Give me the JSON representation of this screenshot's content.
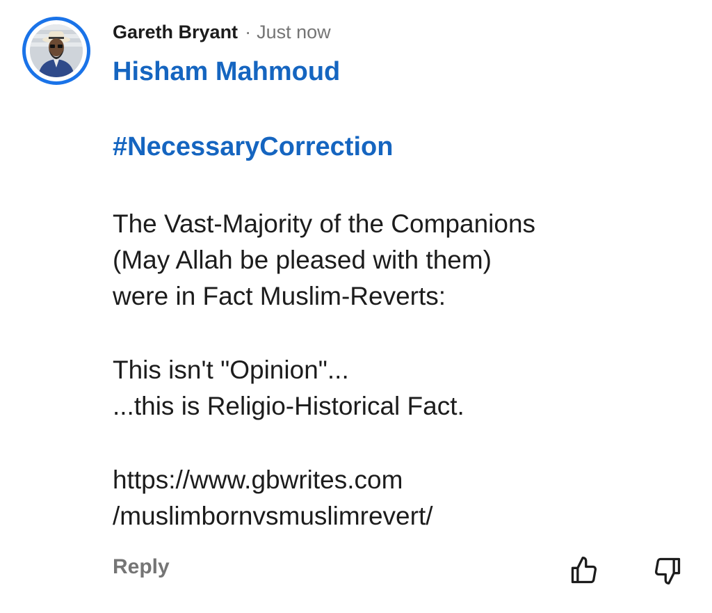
{
  "comment": {
    "author": "Gareth Bryant",
    "separator": "·",
    "timestamp": "Just now",
    "mention": "Hisham Mahmoud",
    "hashtag": "#NecessaryCorrection",
    "body_lines": [
      "The Vast-Majority of the Companions",
      "(May Allah be pleased with them)",
      "were in Fact Muslim-Reverts:",
      "This isn't \"Opinion\"...",
      "...this is Religio-Historical Fact.",
      "https://www.gbwrites.com",
      "/muslimbornvsmuslimrevert/"
    ]
  },
  "actions": {
    "reply_label": "Reply",
    "like_icon": "thumbs-up-icon",
    "dislike_icon": "thumbs-down-icon"
  },
  "colors": {
    "accent": "#1a73e8",
    "link": "#1565c0",
    "muted": "#757575",
    "text": "#1c1c1c"
  }
}
